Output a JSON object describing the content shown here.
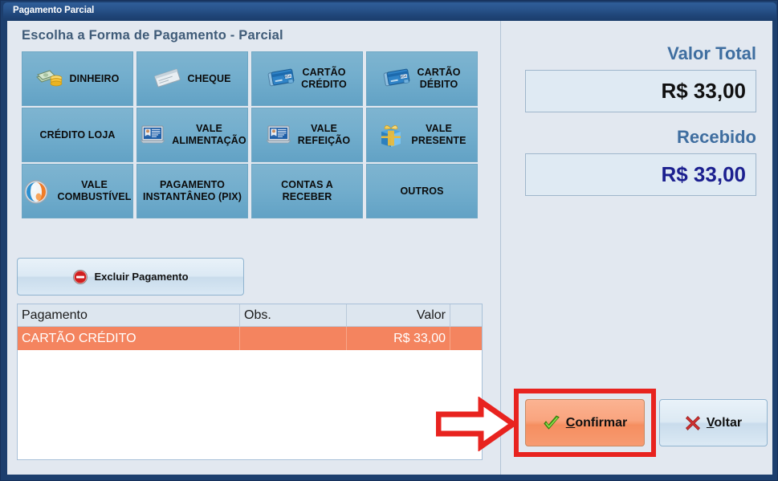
{
  "window": {
    "title": "Pagamento Parcial"
  },
  "left": {
    "section_title": "Escolha a Forma de Pagamento - Parcial",
    "payment_buttons": [
      {
        "label": "DINHEIRO",
        "icon": "money-icon",
        "has_icon": true
      },
      {
        "label": "CHEQUE",
        "icon": "cheque-icon",
        "has_icon": true
      },
      {
        "label": "CARTÃO\nCRÉDITO",
        "icon": "credit-card-icon",
        "has_icon": true
      },
      {
        "label": "CARTÃO\nDÉBITO",
        "icon": "debit-card-icon",
        "has_icon": true
      },
      {
        "label": "CRÉDITO LOJA",
        "icon": "none",
        "has_icon": false
      },
      {
        "label": "VALE\nALIMENTAÇÃO",
        "icon": "voucher-card-icon",
        "has_icon": true
      },
      {
        "label": "VALE\nREFEIÇÃO",
        "icon": "voucher-card-icon",
        "has_icon": true
      },
      {
        "label": "VALE\nPRESENTE",
        "icon": "gift-icon",
        "has_icon": true
      },
      {
        "label": "VALE\nCOMBUSTÍVEL",
        "icon": "fuel-icon",
        "has_icon": true
      },
      {
        "label": "PAGAMENTO\nINSTANTÂNEO (PIX)",
        "icon": "none",
        "has_icon": false
      },
      {
        "label": "CONTAS A\nRECEBER",
        "icon": "none",
        "has_icon": false
      },
      {
        "label": "OUTROS",
        "icon": "none",
        "has_icon": false
      }
    ],
    "delete_button": {
      "label": "Excluir Pagamento",
      "icon": "delete-forbidden-icon"
    },
    "table": {
      "columns": [
        "Pagamento",
        "Obs.",
        "Valor"
      ],
      "rows": [
        {
          "pagamento": "CARTÃO CRÉDITO",
          "obs": "",
          "valor": "R$ 33,00",
          "selected": true
        }
      ]
    }
  },
  "right": {
    "total": {
      "label": "Valor Total",
      "value": "R$ 33,00",
      "value_color": "#101010"
    },
    "received": {
      "label": "Recebido",
      "value": "R$ 33,00",
      "value_color": "#1b1f8f"
    },
    "confirm_button": {
      "accesskey": "C",
      "label_rest": "onfirmar",
      "icon": "green-check-icon",
      "highlighted": true,
      "highlight_color": "#e8231f"
    },
    "back_button": {
      "accesskey": "V",
      "label_rest": "oltar",
      "icon": "red-x-icon"
    }
  },
  "annotation": {
    "arrow": "red-arrow-pointing-right",
    "arrow_color": "#e8231f"
  },
  "colors": {
    "title_bar": "#29548c",
    "panel_bg": "#e2e8f0",
    "payment_button": "#73aecd",
    "selected_row": "#f4845f",
    "label_blue": "#3f6ea0"
  }
}
